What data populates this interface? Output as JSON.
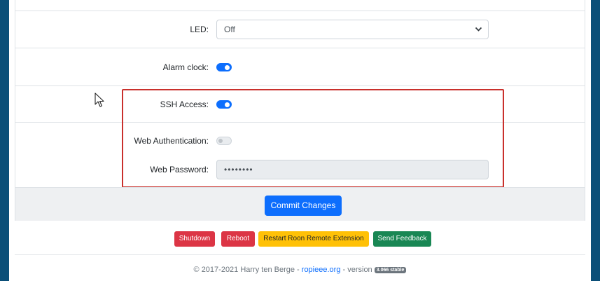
{
  "settings": {
    "led_label": "LED:",
    "led_value": "Off",
    "alarm_label": "Alarm clock:",
    "alarm_enabled": true,
    "ssh_label": "SSH Access:",
    "ssh_enabled": true,
    "web_auth_label": "Web Authentication:",
    "web_auth_enabled": false,
    "web_password_label": "Web Password:",
    "web_password_value": "••••••••"
  },
  "actions": {
    "commit_label": "Commit Changes",
    "shutdown_label": "Shutdown",
    "reboot_label": "Reboot",
    "restart_label": "Restart Roon Remote Extension",
    "feedback_label": "Send Feedback"
  },
  "footer": {
    "copyright_prefix": "© 2017-2021 Harry ten Berge -",
    "site_link": "ropieee.org",
    "version_text": "- version",
    "version_badge": "3.066 stable"
  },
  "icons": {
    "chevron": "chevron-down-icon",
    "cursor": "mouse-pointer-icon"
  },
  "colors": {
    "primary": "#0d6efd",
    "danger": "#dc3545",
    "warning": "#ffc107",
    "success": "#198754",
    "highlight": "#c9302c"
  }
}
